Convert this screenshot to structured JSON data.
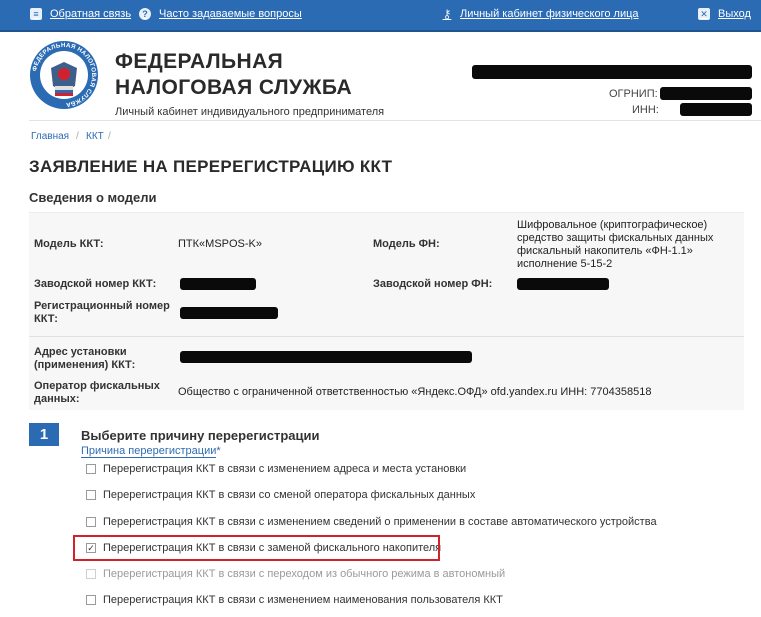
{
  "topbar": {
    "feedback": "Обратная связь",
    "faq": "Часто задаваемые вопросы",
    "personal_cabinet": "Личный кабинет физического лица",
    "logout": "Выход"
  },
  "header": {
    "org_line1": "ФЕДЕРАЛЬНАЯ",
    "org_line2": "НАЛОГОВАЯ СЛУЖБА",
    "subtitle": "Личный кабинет индивидуального предпринимателя",
    "emblem_text": "ФЕДЕРАЛЬНАЯ НАЛОГОВАЯ СЛУЖБА",
    "ogrnip_label": "ОГРНИП:",
    "inn_label": "ИНН:"
  },
  "breadcrumb": {
    "home": "Главная",
    "kkt": "ККТ",
    "sep": "/"
  },
  "page_title": "ЗАЯВЛЕНИЕ НА ПЕРЕРЕГИСТРАЦИЮ ККТ",
  "model_section": {
    "title": "Сведения о модели",
    "kkt_model_label": "Модель ККТ:",
    "kkt_model_value": "ПТК«MSPOS-K»",
    "fn_model_label": "Модель ФН:",
    "fn_model_value": "Шифровальное (криптографическое) средство защиты фискальных данных фискальный накопитель «ФН-1.1» исполнение 5-15-2",
    "serial_kkt_label": "Заводской номер ККТ:",
    "serial_fn_label": "Заводской номер ФН:",
    "reg_number_label": "Регистрационный номер ККТ:",
    "address_label": "Адрес установки (применения) ККТ:",
    "ofd_label": "Оператор фискальных данных:",
    "ofd_value": "Общество с ограниченной ответственностью «Яндекс.ОФД» ofd.yandex.ru ИНН: 7704358518"
  },
  "step": {
    "number": "1",
    "title": "Выберите причину перерегистрации",
    "reason_label": "Причина перерегистрации",
    "required_mark": "*",
    "check_mark": "✓",
    "options": [
      {
        "label": "Перерегистрация ККТ в связи с изменением адреса и места установки",
        "checked": false,
        "disabled": false
      },
      {
        "label": "Перерегистрация ККТ в связи со сменой оператора фискальных данных",
        "checked": false,
        "disabled": false
      },
      {
        "label": "Перерегистрация ККТ в связи с изменением сведений о применении в составе автоматического устройства",
        "checked": false,
        "disabled": false
      },
      {
        "label": "Перерегистрация ККТ в связи с заменой фискального накопителя",
        "checked": true,
        "disabled": false
      },
      {
        "label": "Перерегистрация ККТ в связи с переходом из обычного режима в автономный",
        "checked": false,
        "disabled": true
      },
      {
        "label": "Перерегистрация ККТ в связи с изменением наименования пользователя ККТ",
        "checked": false,
        "disabled": false
      }
    ]
  },
  "colors": {
    "topbar": "#2b6bb3",
    "link": "#2f6cb2",
    "highlight": "#d2202d",
    "panel": "#f7f7f7"
  },
  "icons": [
    "feedback-icon",
    "question-icon",
    "key-icon",
    "close-icon",
    "fns-emblem",
    "checkbox-icon"
  ]
}
